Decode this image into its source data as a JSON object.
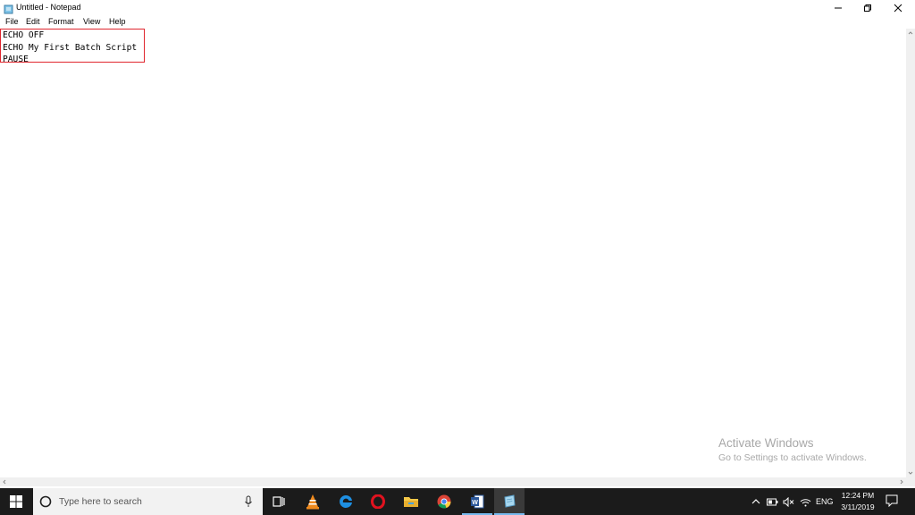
{
  "window": {
    "title": "Untitled - Notepad"
  },
  "menu": [
    {
      "label": "File"
    },
    {
      "label": "Edit"
    },
    {
      "label": "Format"
    },
    {
      "label": "View"
    },
    {
      "label": "Help"
    }
  ],
  "editor": {
    "lines": [
      "ECHO OFF",
      "ECHO My First Batch Script",
      "PAUSE"
    ],
    "highlight_color": "#e0262e"
  },
  "watermark": {
    "title": "Activate Windows",
    "subtitle": "Go to Settings to activate Windows."
  },
  "taskbar": {
    "search_placeholder": "Type here to search",
    "apps": [
      "task-view-icon",
      "vlc-icon",
      "edge-icon",
      "opera-icon",
      "file-explorer-icon",
      "chrome-icon",
      "word-icon",
      "notepad-icon"
    ],
    "tray": {
      "language": "ENG",
      "time": "12:24 PM",
      "date": "3/11/2019"
    }
  }
}
